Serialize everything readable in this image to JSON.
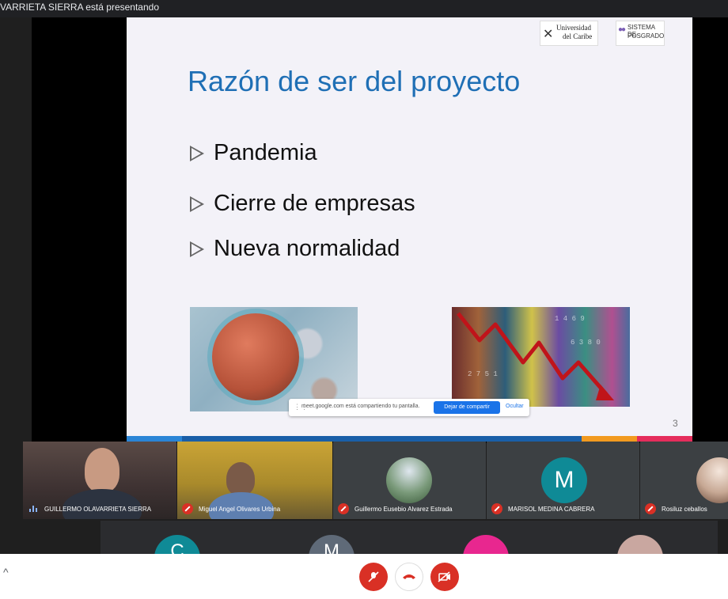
{
  "top_bar": {
    "presenting_text": "VARRIETA SIERRA está presentando"
  },
  "slide": {
    "logo_left": {
      "line1": "Universidad",
      "line2": "del Caribe"
    },
    "logo_right": {
      "line1": "SISTEMA DE",
      "line2": "POSGRADO"
    },
    "title": "Razón de ser del proyecto",
    "bullets": [
      "Pandemia",
      "Cierre de empresas",
      "Nueva normalidad"
    ],
    "page_number": "3",
    "footer_colors": [
      "#2b85d6",
      "#1a5fa8",
      "#f29a1f",
      "#e52d5c"
    ]
  },
  "share_banner": {
    "message": "meet.google.com está compartiendo tu pantalla.",
    "stop_label": "Dejar de compartir",
    "hide_label": "Ocultar"
  },
  "participants": [
    {
      "name": "GUILLERMO OLAVARRIETA SIERRA",
      "muted": false
    },
    {
      "name": "Miguel Angel Olivares Urbina",
      "muted": true
    },
    {
      "name": "Guillermo Eusebio Alvarez Estrada",
      "muted": true
    },
    {
      "name": "MARISOL MEDINA CABRERA",
      "muted": true,
      "initial": "M"
    },
    {
      "name": "Rosiluz ceballos",
      "muted": true
    }
  ],
  "second_row": {
    "initials": [
      "C",
      "M",
      "",
      ""
    ],
    "colors": [
      "#0f8a96",
      "#5f6a78",
      "#e8278f",
      "#c9a7a0"
    ]
  },
  "controls": {
    "mic_icon": "mic-off-icon",
    "hangup_icon": "phone-hangup-icon",
    "camera_icon": "camera-off-icon",
    "accent": "#d93025"
  }
}
